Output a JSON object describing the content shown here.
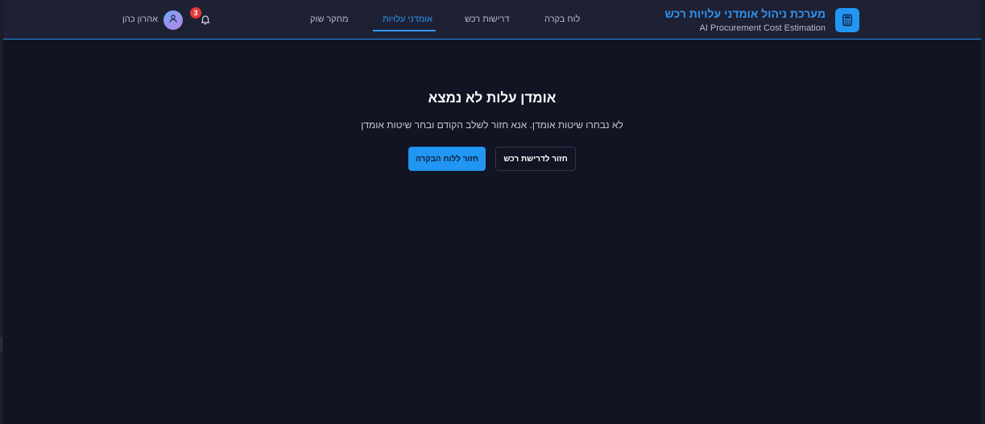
{
  "header": {
    "app_title": "מערכת ניהול אומדני עלויות רכש",
    "app_subtitle": "AI Procurement Cost Estimation",
    "app_icon": "calculator-icon",
    "accent_color": "#2196f3"
  },
  "nav": {
    "tabs": [
      {
        "label": "לוח בקרה",
        "active": false
      },
      {
        "label": "דרישות רכש",
        "active": false
      },
      {
        "label": "אומדני עלויות",
        "active": true
      },
      {
        "label": "מחקר שוק",
        "active": false
      }
    ]
  },
  "user": {
    "name": "אהרון כהן",
    "notification_count": "3",
    "avatar_icon": "user-icon",
    "bell_icon": "bell-icon"
  },
  "main": {
    "title": "אומדן עלות לא נמצא",
    "message": "לא נבחרו שיטות אומדן. אנא חזור לשלב הקודם ובחר שיטות אומדן",
    "back_to_requirement_label": "חזור לדרישת רכש",
    "back_to_dashboard_label": "חזור ללוח הבקרה"
  }
}
